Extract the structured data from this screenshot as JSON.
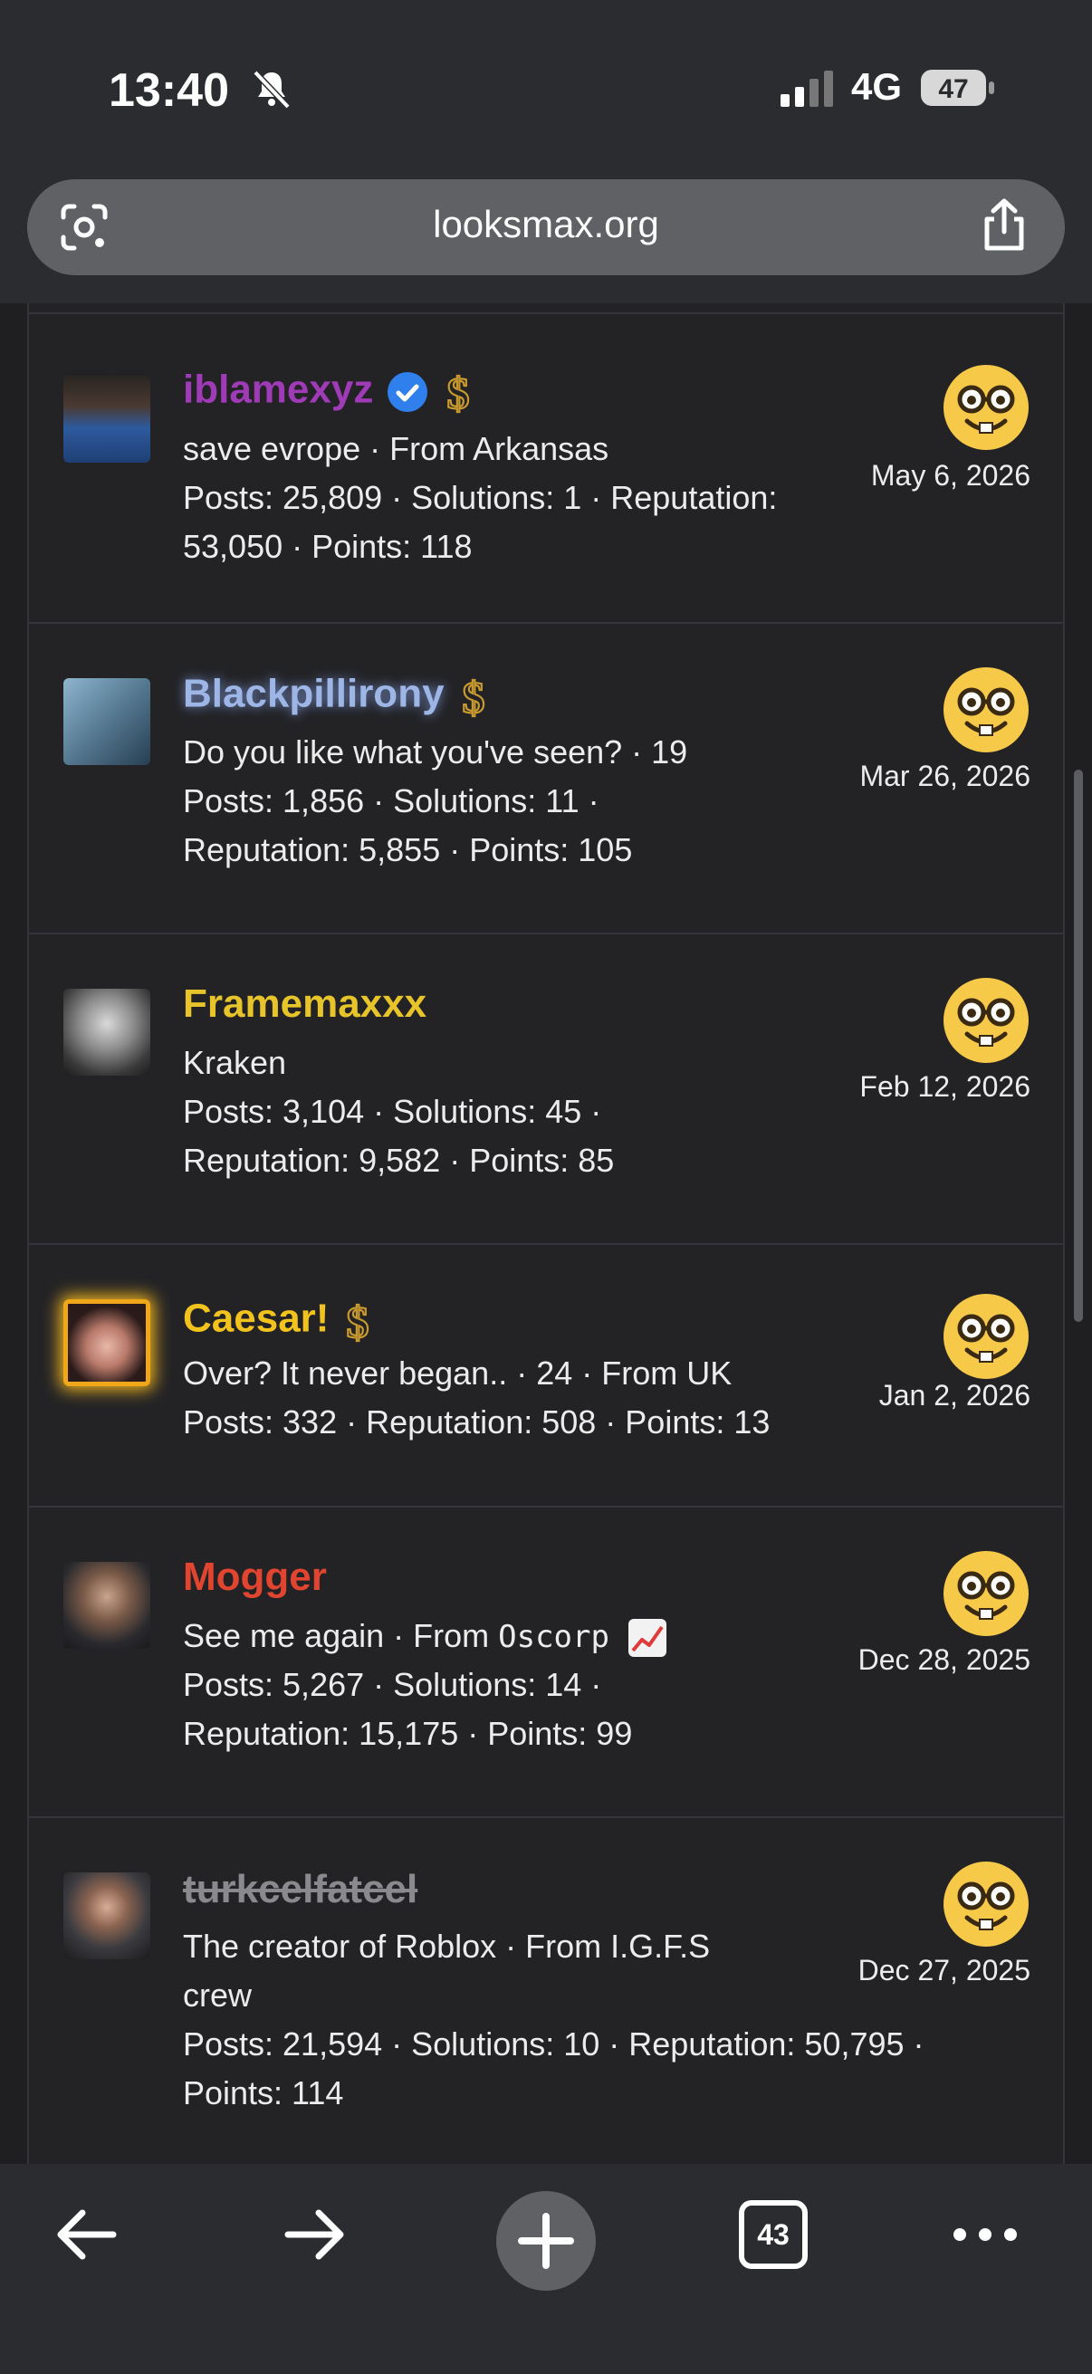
{
  "status": {
    "time": "13:40",
    "network": "4G",
    "battery": "47"
  },
  "browser": {
    "url": "looksmax.org",
    "tab_count": "43"
  },
  "members": [
    {
      "username": "iblamexyz",
      "name_color": "#a03bb8",
      "verified": true,
      "donor": true,
      "lines": [
        "save evrope · From Arkansas",
        "Posts: 25,809 · Solutions: 1 · Reputation:",
        "53,050 · Points: 118"
      ],
      "date": "May 6, 2026"
    },
    {
      "username": "Blackpillirony",
      "name_color": "#9db6e6",
      "verified": false,
      "donor": true,
      "lines": [
        "Do you like what you've seen? · 19",
        "Posts: 1,856 · Solutions: 11 ·",
        "Reputation: 5,855 · Points: 105"
      ],
      "date": "Mar 26, 2026"
    },
    {
      "username": "Framemaxxx",
      "name_color": "#e6c42a",
      "verified": false,
      "donor": false,
      "lines": [
        "Kraken",
        "Posts: 3,104 · Solutions: 45 ·",
        "Reputation: 9,582 · Points: 85"
      ],
      "date": "Feb 12, 2026"
    },
    {
      "username": "Caesar!",
      "name_color": "#f2c21d",
      "verified": false,
      "donor": true,
      "lines": [
        "Over? It never began.. · 24 · From UK",
        "Posts: 332 · Reputation: 508 · Points: 13"
      ],
      "date": "Jan 2, 2026"
    },
    {
      "username": "Mogger",
      "name_color": "#e2452f",
      "verified": false,
      "donor": false,
      "line1_pre": "See me again · From ",
      "line1_mono": "Oscorp",
      "lines": [
        "Posts: 5,267 · Solutions: 14 ·",
        "Reputation: 15,175 · Points: 99"
      ],
      "date": "Dec 28, 2025"
    },
    {
      "username": "turkcelfatcel",
      "name_color": "#8a8a8e",
      "verified": false,
      "donor": false,
      "lines": [
        "The creator of Roblox · From I.G.F.S",
        "crew",
        "Posts: 21,594 · Solutions: 10 · Reputation: 50,795 ·",
        "Points: 114"
      ],
      "date": "Dec 27, 2025"
    }
  ],
  "icons": {
    "row_emoji": "nerd-face-icon",
    "donor": "dollar-icon",
    "verified": "verified-badge-icon"
  },
  "colors": {
    "background": "#1f1f21",
    "chrome": "#2b2c2f"
  }
}
